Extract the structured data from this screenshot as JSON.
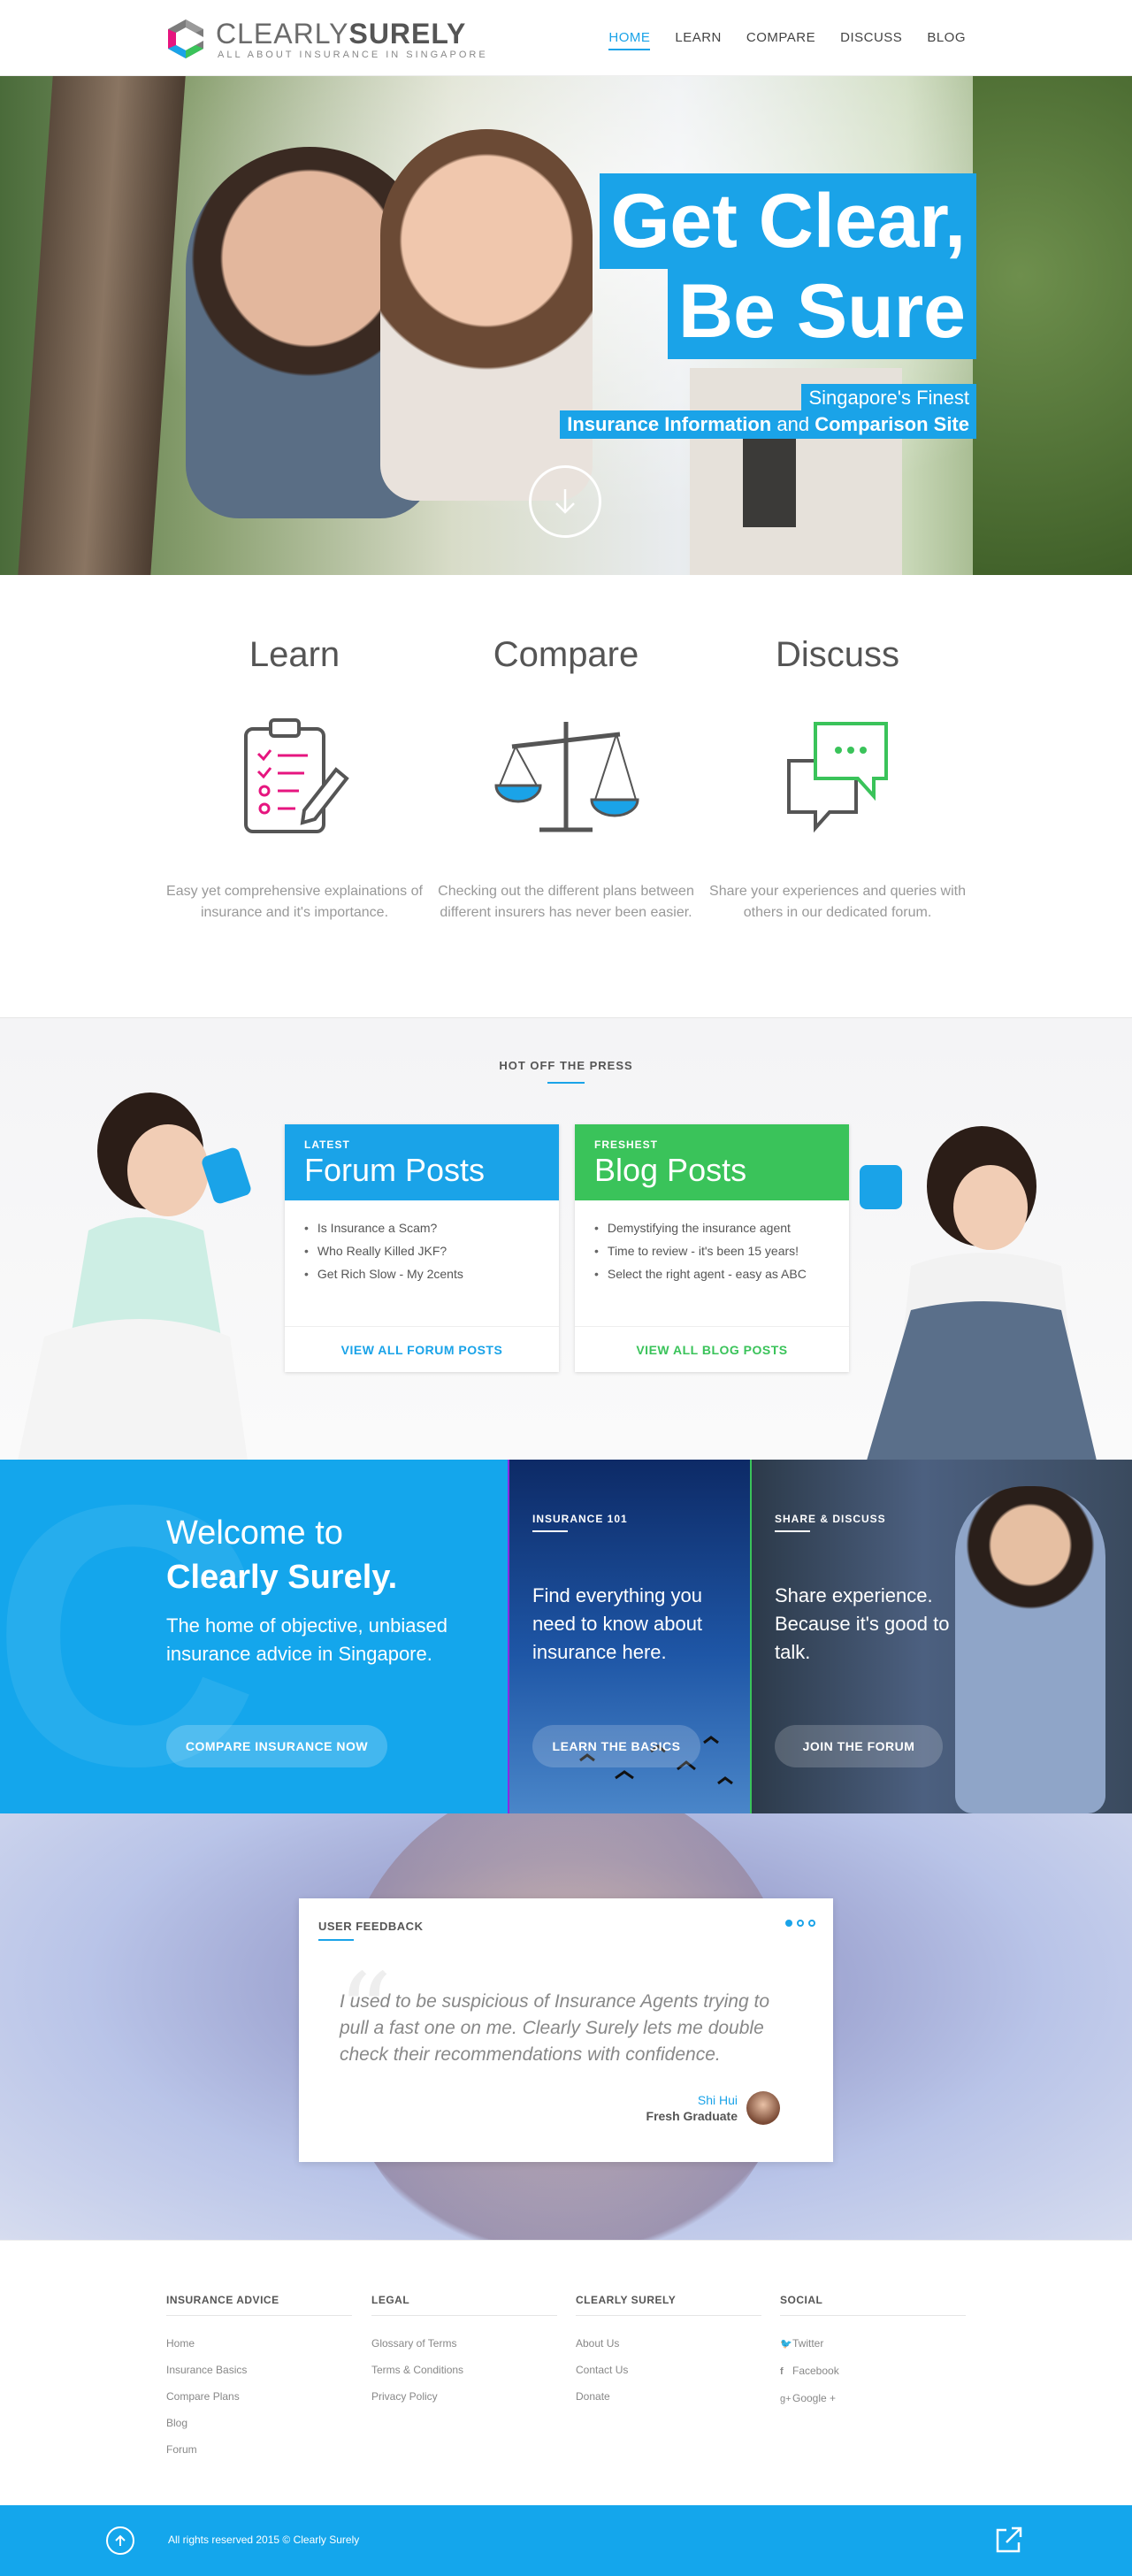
{
  "brand": {
    "name_light": "CLEARLY",
    "name_bold": "SURELY",
    "tagline": "ALL ABOUT INSURANCE IN SINGAPORE"
  },
  "nav": {
    "items": [
      {
        "label": "HOME",
        "active": true
      },
      {
        "label": "LEARN",
        "active": false
      },
      {
        "label": "COMPARE",
        "active": false
      },
      {
        "label": "DISCUSS",
        "active": false
      },
      {
        "label": "BLOG",
        "active": false
      }
    ]
  },
  "hero": {
    "headline_1": "Get Clear,",
    "headline_2": "Be Sure",
    "sub_1": "Singapore's Finest",
    "sub_2_bold_a": "Insurance Information",
    "sub_2_mid": " and ",
    "sub_2_bold_b": "Comparison Site",
    "scroll_icon": "arrow-down-circle-icon"
  },
  "features": [
    {
      "title": "Learn",
      "icon": "clipboard-checklist-icon",
      "text": "Easy yet comprehensive explainations of insurance and it's importance."
    },
    {
      "title": "Compare",
      "icon": "balance-scale-icon",
      "text": "Checking out the different plans between different insurers has never been easier."
    },
    {
      "title": "Discuss",
      "icon": "chat-bubbles-icon",
      "text": "Share your experiences and queries with others in our dedicated forum."
    }
  ],
  "press": {
    "title": "HOT OFF THE PRESS",
    "forum": {
      "tag": "LATEST",
      "title": "Forum Posts",
      "items": [
        "Is Insurance a Scam?",
        "Who Really Killed JKF?",
        "Get Rich Slow - My 2cents"
      ],
      "link": "VIEW ALL FORUM POSTS",
      "color": "#1aa3e8"
    },
    "blog": {
      "tag": "FRESHEST",
      "title": "Blog Posts",
      "items": [
        "Demystifying the insurance agent",
        "Time to review - it's been 15 years!",
        "Select the right agent - easy as ABC"
      ],
      "link": "VIEW ALL BLOG POSTS",
      "color": "#3ac35a"
    }
  },
  "welcome": {
    "title_1": "Welcome to",
    "title_2": "Clearly Surely.",
    "desc": "The home of objective, unbiased insurance advice in Singapore.",
    "cta": "COMPARE INSURANCE NOW",
    "tile_1": {
      "tag": "INSURANCE 101",
      "text": "Find everything you need to know about insurance here.",
      "cta": "LEARN THE BASICS"
    },
    "tile_2": {
      "tag": "SHARE & DISCUSS",
      "text": "Share experience. Because it's good to talk.",
      "cta": "JOIN THE FORUM"
    }
  },
  "feedback": {
    "tag": "USER FEEDBACK",
    "quote": "I used to be suspicious of Insurance Agents trying to pull a fast one on me. Clearly Surely lets me double check their recommendations with confidence.",
    "name": "Shi Hui",
    "role": "Fresh Graduate",
    "slides": 3,
    "active_slide": 1
  },
  "footer": {
    "columns": [
      {
        "title": "INSURANCE ADVICE",
        "links": [
          "Home",
          "Insurance Basics",
          "Compare Plans",
          "Blog",
          "Forum"
        ]
      },
      {
        "title": "LEGAL",
        "links": [
          "Glossary of Terms",
          "Terms & Conditions",
          "Privacy Policy"
        ]
      },
      {
        "title": "CLEARLY SURELY",
        "links": [
          "About Us",
          "Contact Us",
          "Donate"
        ]
      },
      {
        "title": "SOCIAL",
        "links": [
          "Twitter",
          "Facebook",
          "Google +"
        ],
        "icons": [
          "twitter-icon",
          "facebook-icon",
          "google-plus-icon"
        ]
      }
    ],
    "copyright": "All rights reserved 2015 © Clearly Surely",
    "accent": "#14a6ec"
  }
}
